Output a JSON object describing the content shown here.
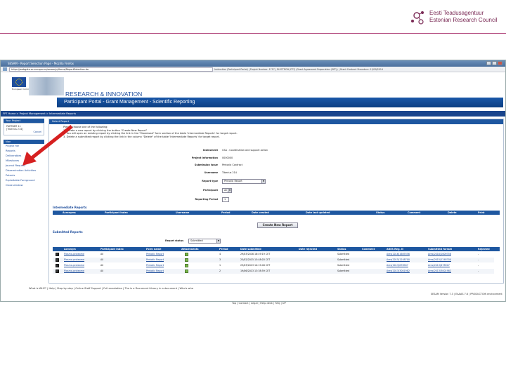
{
  "logo": {
    "line1": "Eesti Teadusagentuur",
    "line2": "Estonian Research Council"
  },
  "browser": {
    "window_title": "SESAM - Report Selection Page - Mozilla Firefox",
    "url": "https://webgate.ec.europa.eu/sesam/p/Home/ReportSelection.do",
    "meta": "Instruction (Participant Portal) | Project Number: 1717 | ELECTRON (FP7) (Grant Agreement Preparation (GPF)) | Grant Contract Procedure: 15/09/2014"
  },
  "banner": {
    "eu_text": "European Commission",
    "ri_title": "RESEARCH & INNOVATION",
    "portal_title": "Participant Portal - Grant Management - Scientific Reporting"
  },
  "breadcrumb": "FP7 Home > Project Management > Intermediate Reports",
  "sidebar": {
    "project_head": "Your Project",
    "project_info": [
      "PARTNER 11",
      "[Tiberius 214]"
    ],
    "project_action": "Cancel",
    "nav_head": "Nav",
    "items": [
      "Project file",
      "Reports",
      "Deliverables",
      "Milestones",
      "Journal Request",
      "Dissemination Activities",
      "Patents",
      "Exploitable Foreground",
      "Close window"
    ]
  },
  "main": {
    "header": "Select Report",
    "instructions": [
      "Please choose one of the following:",
      "1. Create a new report by clicking the button \"Create New Report\"",
      "2. You will open an existing report by clicking the link in the \"Download\" form section of the table 'Intermediate Reports' for target report.",
      "3. Delete a submitted report by clicking the link in the column \"Delete\" of the table 'Intermediate Reports' for target report."
    ],
    "form": [
      {
        "label": "Instrument",
        "value": "CSA - Coordination and support action"
      },
      {
        "label": "Project Information",
        "value": "0000000"
      },
      {
        "label": "Submission Issue",
        "value": "Periodic Contract"
      },
      {
        "label": "Username",
        "value": "Tiberius 214"
      }
    ],
    "report_type": {
      "label": "Report type",
      "value": "Periodic Report"
    },
    "participant": {
      "label": "Participant",
      "value": "All"
    },
    "reporting_period": {
      "label": "Reporting Period",
      "value": "1"
    },
    "intermediate": {
      "title": "Intermediate Reports",
      "columns": [
        "Acronyms",
        "Participant Index",
        "Username",
        "Period",
        "Date created",
        "Date last updated",
        "Status",
        "Comment",
        "Delete",
        "Print"
      ],
      "button": "Create New Report"
    },
    "submitted": {
      "title": "Submitted Reports",
      "status_label": "Report status",
      "status_value": "Submitted",
      "columns": [
        "Acronym",
        "Participant Index",
        "Form name",
        "Attachments",
        "Period",
        "Date submitted",
        "Date rejected",
        "Status",
        "Comment",
        "ARES Reg. N",
        "Submitted format",
        "Rejected"
      ],
      "rows": [
        {
          "acronym": "Plasma-proteome",
          "participant": "All",
          "form": "Periodic Report",
          "period": "4",
          "date": "29/03/2016 16:49:19 CET",
          "status": "Submitted",
          "ares": "Ares(2016)1609356",
          "format": "Ares(2016)1609356",
          "rejected": "-"
        },
        {
          "acronym": "Plasma-proteome",
          "participant": "All",
          "form": "Periodic Report",
          "period": "3",
          "date": "25/02/2015 15:48:03 CET",
          "status": "Submitted",
          "ares": "Ares(2015)1248700",
          "format": "Ares(2015)1248700",
          "rejected": "-"
        },
        {
          "acronym": "Plasma-proteome",
          "participant": "All",
          "form": "Periodic Report",
          "period": "1",
          "date": "29/03/2013 10:19:48 CET",
          "status": "Submitted",
          "ares": "Ares(2013)678907",
          "format": "Ares(2013)678907",
          "rejected": "-"
        },
        {
          "acronym": "Plasma-proteome",
          "participant": "All",
          "form": "Periodic Report",
          "period": "2",
          "date": "19/06/2013 13:38:59 CET",
          "status": "Submitted",
          "ares": "Ares(2013)3001982",
          "format": "Ares(2013)3001982",
          "rejected": "-"
        }
      ]
    }
  },
  "footer": {
    "text": "What is WHY? | Help | Step by step | Online Staff Support | Full annotation | The is a Document Library in a document | Who's who",
    "links": "Top | Contact | Legal | Help desk | FAQ | DP",
    "right": "SESAM Version 7.3 | EAAAS 7.6 | PRODUCTION environment"
  },
  "colors": {
    "portal_blue": "#1e57a0",
    "dark_blue": "#19448c",
    "logo_magenta": "#7a2a55",
    "arrow_red": "#d62020"
  }
}
